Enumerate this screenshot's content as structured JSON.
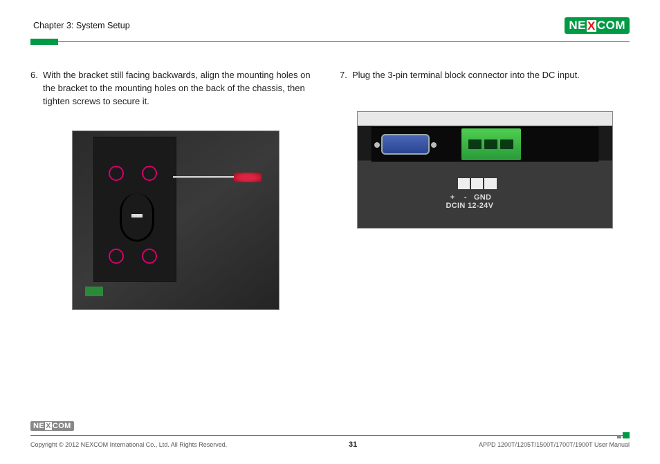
{
  "header": {
    "chapter": "Chapter 3: System Setup",
    "brand_left": "NE",
    "brand_x": "X",
    "brand_right": "COM"
  },
  "steps": {
    "six_num": "6.",
    "six_text": "With the bracket still facing backwards, align the mounting holes on the bracket to the mounting holes on the back of the chassis, then tighten screws to secure it.",
    "seven_num": "7.",
    "seven_text": "Plug the 3-pin terminal block connector into the DC input."
  },
  "photo_right": {
    "label": " +    -   GND\nDCIN 12-24V"
  },
  "footer": {
    "logo_left": "NE",
    "logo_x": "X",
    "logo_right": "COM",
    "copyright": "Copyright © 2012 NEXCOM International Co., Ltd. All Rights Reserved.",
    "page": "31",
    "manual": "APPD 1200T/1205T/1500T/1700T/1900T User Manual"
  }
}
